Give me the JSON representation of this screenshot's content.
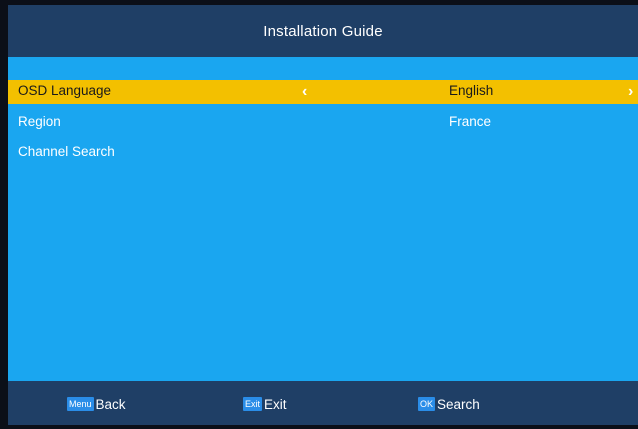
{
  "header": {
    "title": "Installation Guide"
  },
  "menu": {
    "items": [
      {
        "label": "OSD Language",
        "value": "English",
        "selected": true,
        "left_arrow": "‹",
        "right_arrow": "›"
      },
      {
        "label": "Region",
        "value": "France",
        "selected": false
      },
      {
        "label": "Channel Search",
        "value": "",
        "selected": false
      }
    ]
  },
  "footer": {
    "hints": [
      {
        "key": "Menu",
        "label": "Back"
      },
      {
        "key": "Exit",
        "label": "Exit"
      },
      {
        "key": "OK",
        "label": "Search"
      }
    ]
  },
  "colors": {
    "frame": "#1f3f66",
    "content_bg": "#1aa6f0",
    "highlight": "#f3c000",
    "key_badge": "#2a8de8",
    "text": "#ffffff"
  }
}
